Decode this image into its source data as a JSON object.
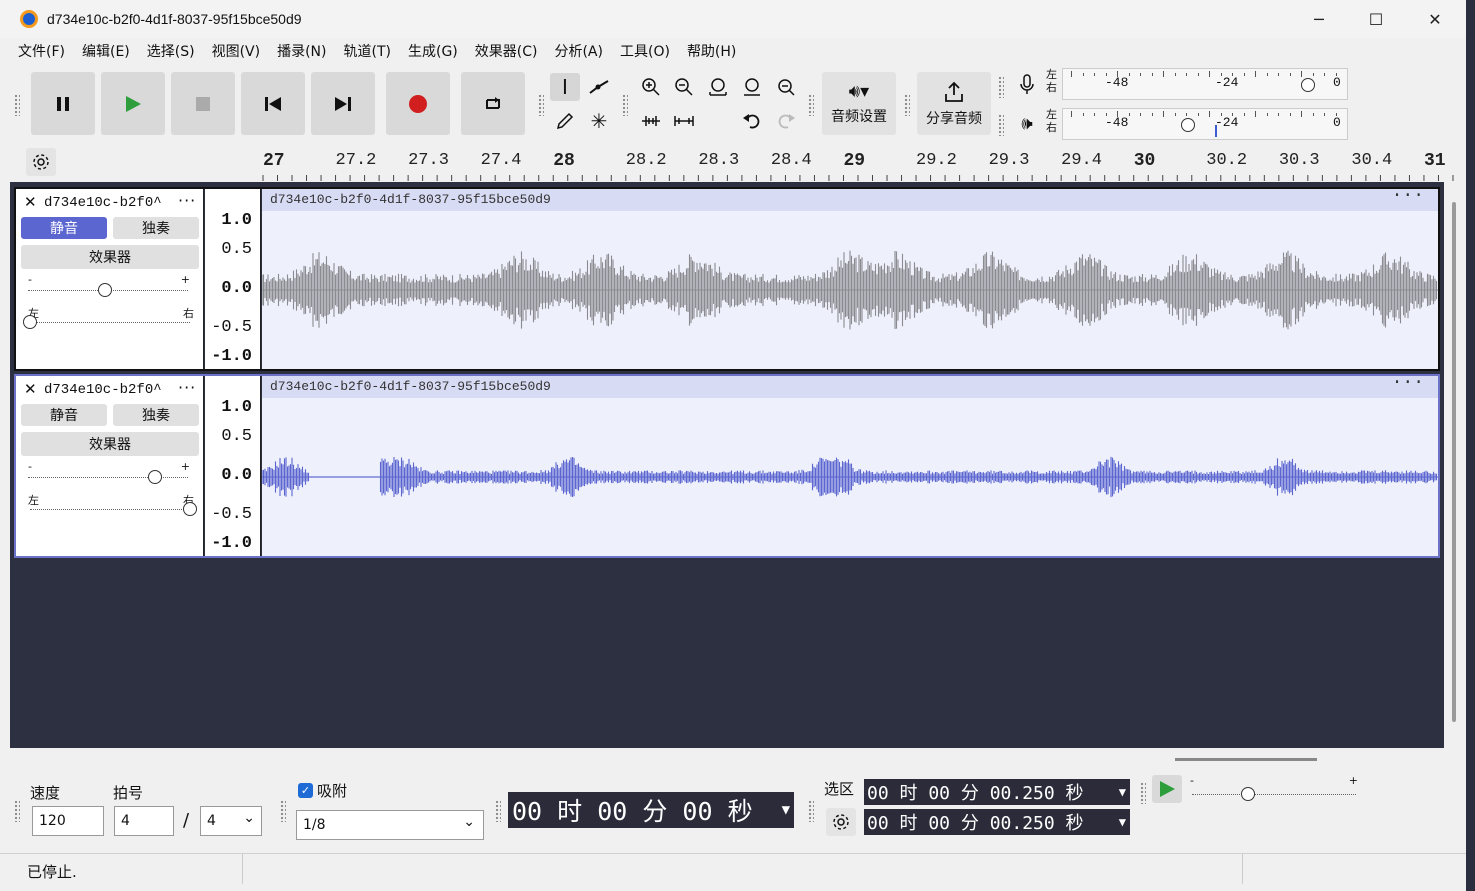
{
  "window": {
    "title": "d734e10c-b2f0-4d1f-8037-95f15bce50d9",
    "minimize": "─",
    "maximize": "☐",
    "close": "✕"
  },
  "menu": [
    "文件(F)",
    "编辑(E)",
    "选择(S)",
    "视图(V)",
    "播录(N)",
    "轨道(T)",
    "生成(G)",
    "效果器(C)",
    "分析(A)",
    "工具(O)",
    "帮助(H)"
  ],
  "toolbar": {
    "audio_setup_label": "音频设置",
    "share_label": "分享音频"
  },
  "meters": {
    "left": "左",
    "right": "右",
    "tick_48": "-48",
    "tick_24": "-24",
    "tick_0": "0"
  },
  "ruler": {
    "labels": [
      "27",
      "27.2",
      "27.3",
      "27.4",
      "28",
      "28.2",
      "28.3",
      "28.4",
      "29",
      "29.2",
      "29.3",
      "29.4",
      "30",
      "30.2",
      "30.3",
      "30.4",
      "31"
    ],
    "bold": [
      "27",
      "28",
      "29",
      "30",
      "31"
    ]
  },
  "tracks": [
    {
      "name": "d734e10c-b2f0^",
      "mute": "静音",
      "solo": "独奏",
      "effects": "效果器",
      "gain_minus": "-",
      "gain_plus": "+",
      "pan_left": "左",
      "pan_right": "右",
      "clip_name": "d734e10c-b2f0-4d1f-8037-95f15bce50d9",
      "mute_on": true,
      "scale": [
        "1.0",
        "0.5",
        "0.0",
        "-0.5",
        "-1.0"
      ]
    },
    {
      "name": "d734e10c-b2f0^",
      "mute": "静音",
      "solo": "独奏",
      "effects": "效果器",
      "gain_minus": "-",
      "gain_plus": "+",
      "pan_left": "左",
      "pan_right": "右",
      "clip_name": "d734e10c-b2f0-4d1f-8037-95f15bce50d9",
      "mute_on": false,
      "scale": [
        "1.0",
        "0.5",
        "0.0",
        "-0.5",
        "-1.0"
      ]
    }
  ],
  "bottom": {
    "tempo_label": "速度",
    "tempo_value": "120",
    "meter_label": "拍号",
    "meter_num": "4",
    "meter_slash": "/",
    "meter_den": "4",
    "snap_label": "吸附",
    "snap_value": "1/8",
    "time_display": "00 时 00 分 00 秒",
    "selection_label": "选区",
    "sel_start": "00 时 00 分 00.250 秒",
    "sel_end": "00 时 00 分 00.250 秒",
    "speed_minus": "-",
    "speed_plus": "+"
  },
  "status": "已停止.",
  "colors": {
    "accent": "#5b66d0",
    "wave1": "#8a8a8f",
    "wave2": "#5b66d0",
    "record": "#d11f1f",
    "play": "#2e9e3c"
  }
}
